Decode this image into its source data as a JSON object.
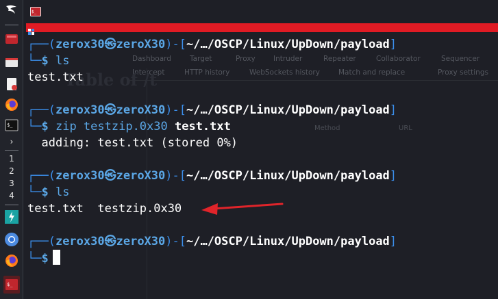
{
  "panel": {
    "workspaces": [
      "1",
      "2",
      "3",
      "4"
    ]
  },
  "background_window": {
    "tabs_row1": [
      "Dashboard",
      "Target",
      "Proxy",
      "Intruder",
      "Repeater",
      "Collaborator",
      "Sequencer"
    ],
    "tabs_row2": [
      "Intercept",
      "HTTP history",
      "WebSockets history",
      "Match and replace",
      "Proxy settings"
    ],
    "heading": "Table of /t",
    "columns": [
      "Method",
      "URL"
    ]
  },
  "terminal": {
    "prompt": {
      "user": "zerox30",
      "host": "zeroX30",
      "path": "~/…/OSCP/Linux/UpDown/payload",
      "symbol": "$"
    },
    "blocks": [
      {
        "command": "ls",
        "args": "",
        "output": "test.txt"
      },
      {
        "command": "zip testzip.0x30 ",
        "args": "test.txt",
        "output": "  adding: test.txt (stored 0%)"
      },
      {
        "command": "ls",
        "args": "",
        "output": "test.txt  testzip.0x30"
      },
      {
        "command": "",
        "args": "",
        "output": ""
      }
    ]
  },
  "colors": {
    "accent_red": "#e01b24",
    "prompt_blue": "#3b8eea",
    "arrow_red": "#e0242a",
    "terminal_bg": "#1e1f26"
  }
}
